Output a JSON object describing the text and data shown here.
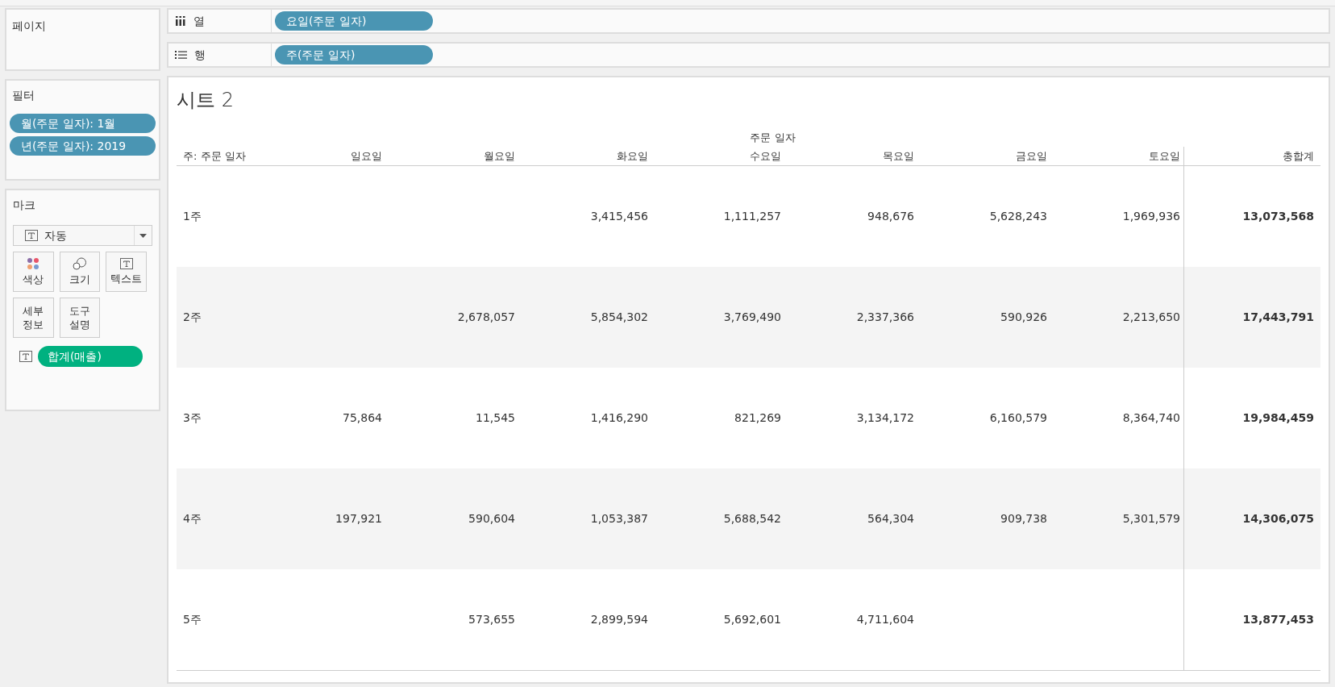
{
  "pages_panel": {
    "title": "페이지"
  },
  "shelves": [
    {
      "kind": "columns",
      "label": "열",
      "pill": "요일(주문 일자)"
    },
    {
      "kind": "rows",
      "label": "행",
      "pill": "주(주문 일자)"
    }
  ],
  "filters": {
    "title": "필터",
    "pills": [
      "월(주문 일자): 1월",
      "년(주문 일자): 2019"
    ]
  },
  "marks": {
    "title": "마크",
    "mark_type": "자동",
    "cards": [
      {
        "kind": "color",
        "label": "색상"
      },
      {
        "kind": "size",
        "label": "크기"
      },
      {
        "kind": "text",
        "label": "텍스트"
      },
      {
        "kind": "detail",
        "label": "세부\n정보"
      },
      {
        "kind": "tooltip",
        "label": "도구\n설명"
      }
    ],
    "fields": [
      {
        "kind": "text",
        "label": "합계(매출)"
      }
    ]
  },
  "sheet": {
    "title": "시트 2",
    "column_group": "주문 일자",
    "row_header": "주: 주문 일자",
    "columns": [
      "일요일",
      "월요일",
      "화요일",
      "수요일",
      "목요일",
      "금요일",
      "토요일"
    ],
    "total_header": "총합계",
    "rows": [
      {
        "label": "1주",
        "cells": [
          null,
          null,
          "3,415,456",
          "1,111,257",
          "948,676",
          "5,628,243",
          "1,969,936"
        ],
        "total": "13,073,568"
      },
      {
        "label": "2주",
        "cells": [
          null,
          "2,678,057",
          "5,854,302",
          "3,769,490",
          "2,337,366",
          "590,926",
          "2,213,650"
        ],
        "total": "17,443,791"
      },
      {
        "label": "3주",
        "cells": [
          "75,864",
          "11,545",
          "1,416,290",
          "821,269",
          "3,134,172",
          "6,160,579",
          "8,364,740"
        ],
        "total": "19,984,459"
      },
      {
        "label": "4주",
        "cells": [
          "197,921",
          "590,604",
          "1,053,387",
          "5,688,542",
          "564,304",
          "909,738",
          "5,301,579"
        ],
        "total": "14,306,075"
      },
      {
        "label": "5주",
        "cells": [
          null,
          "573,655",
          "2,899,594",
          "5,692,601",
          "4,711,604",
          null,
          null
        ],
        "total": "13,877,453"
      }
    ]
  }
}
